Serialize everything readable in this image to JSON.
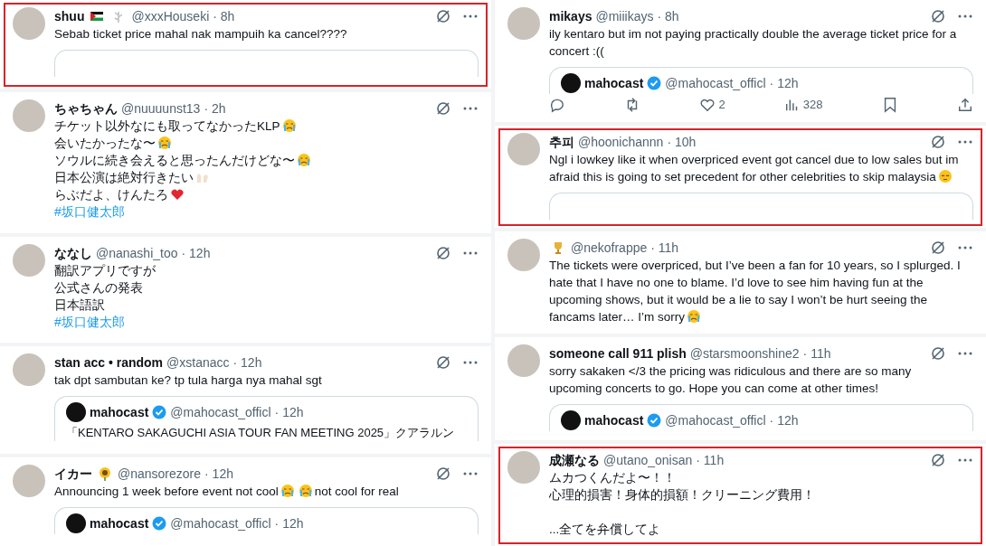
{
  "columns": [
    {
      "tweets": [
        {
          "name": [
            {
              "kind": "text",
              "text": "shuu"
            },
            {
              "kind": "flag"
            },
            {
              "kind": "sprig"
            }
          ],
          "handle": "@xxxHouseki",
          "time": "· 8h",
          "highlighted": true,
          "lines": [
            [
              {
                "kind": "text",
                "text": "Sebab ticket price mahal nak mampuih ka cancel????"
              }
            ]
          ],
          "quote": {
            "kind": "empty"
          }
        },
        {
          "name": [
            {
              "kind": "text",
              "text": "ちゃちゃん"
            }
          ],
          "handle": "@nuuuunst13",
          "time": "· 2h",
          "highlighted": false,
          "lines": [
            [
              {
                "kind": "text",
                "text": "チケット以外なにも取ってなかったKLP"
              },
              {
                "kind": "crying"
              }
            ],
            [
              {
                "kind": "text",
                "text": "会いたかったな〜"
              },
              {
                "kind": "crying"
              }
            ],
            [
              {
                "kind": "text",
                "text": "ソウルに続き会えると思ったんだけどな〜"
              },
              {
                "kind": "crying"
              }
            ],
            [
              {
                "kind": "text",
                "text": "日本公演は絶対行きたい"
              },
              {
                "kind": "hands"
              }
            ],
            [
              {
                "kind": "text",
                "text": "らぶだよ、けんたろ"
              },
              {
                "kind": "heart"
              }
            ]
          ],
          "hashtag": "#坂口健太郎"
        },
        {
          "name": [
            {
              "kind": "text",
              "text": "ななし"
            }
          ],
          "handle": "@nanashi_too",
          "time": "· 12h",
          "highlighted": false,
          "lines": [
            [
              {
                "kind": "text",
                "text": "翻訳アプリですが"
              }
            ],
            [
              {
                "kind": "text",
                "text": "公式さんの発表"
              }
            ],
            [
              {
                "kind": "text",
                "text": "日本語訳"
              }
            ]
          ],
          "hashtag": "#坂口健太郎"
        },
        {
          "name": [
            {
              "kind": "text",
              "text": "stan acc • random"
            }
          ],
          "handle": "@xstanacc",
          "time": "· 12h",
          "highlighted": false,
          "lines": [
            [
              {
                "kind": "text",
                "text": "tak dpt sambutan ke? tp tula harga nya mahal sgt"
              }
            ]
          ],
          "quote": {
            "kind": "post",
            "name": "mahocast",
            "handle": "@mahocast_officl",
            "time": "· 12h",
            "text": "「KENTARO SAKAGUCHI ASIA TOUR FAN MEETING 2025」クアラルン"
          }
        },
        {
          "name": [
            {
              "kind": "text",
              "text": "イカー"
            },
            {
              "kind": "sunflower"
            }
          ],
          "handle": "@nansorezore",
          "time": "· 12h",
          "highlighted": false,
          "lines": [
            [
              {
                "kind": "text",
                "text": "Announcing 1 week before event not cool"
              },
              {
                "kind": "crying"
              },
              {
                "kind": "crying"
              },
              {
                "kind": "text",
                "text": "not cool for real"
              }
            ]
          ],
          "quote": {
            "kind": "post",
            "name": "mahocast",
            "handle": "@mahocast_officl",
            "time": "· 12h"
          }
        }
      ]
    },
    {
      "tweets": [
        {
          "name": [
            {
              "kind": "text",
              "text": "mikays"
            }
          ],
          "handle": "@miiikays",
          "time": "· 8h",
          "highlighted": false,
          "lines": [
            [
              {
                "kind": "text",
                "text": "ily kentaro but im not paying practically double the average ticket price for a"
              }
            ],
            [
              {
                "kind": "text",
                "text": "concert :(("
              }
            ]
          ],
          "quote": {
            "kind": "post",
            "name": "mahocast",
            "handle": "@mahocast_officl",
            "time": "· 12h"
          },
          "actions": [
            {
              "kind": "reply"
            },
            {
              "kind": "retweet"
            },
            {
              "kind": "like",
              "count": "2"
            },
            {
              "kind": "views",
              "count": "328"
            },
            {
              "kind": "bookmark"
            },
            {
              "kind": "share"
            }
          ]
        },
        {
          "name": [
            {
              "kind": "text",
              "text": "추피"
            }
          ],
          "handle": "@hoonichannn",
          "time": "· 10h",
          "highlighted": true,
          "lines": [
            [
              {
                "kind": "text",
                "text": "Ngl i lowkey like it when overpriced event got cancel due to low sales but im"
              }
            ],
            [
              {
                "kind": "text",
                "text": "afraid this is going to set precedent for other celebrities to skip malaysia"
              },
              {
                "kind": "pensive"
              }
            ]
          ],
          "quote": {
            "kind": "empty"
          }
        },
        {
          "name": [
            {
              "kind": "trophy"
            }
          ],
          "handle": "@nekofrappe",
          "time": "· 11h",
          "highlighted": false,
          "lines": [
            [
              {
                "kind": "text",
                "text": "The tickets were overpriced, but I’ve been a fan for 10 years, so I splurged. I"
              }
            ],
            [
              {
                "kind": "text",
                "text": "hate that I have no one to blame. I’d love to see him having fun at the"
              }
            ],
            [
              {
                "kind": "text",
                "text": "upcoming shows, but it would be a lie to say I won’t be hurt seeing the"
              }
            ],
            [
              {
                "kind": "text",
                "text": "fancams later… I’m sorry"
              },
              {
                "kind": "crying"
              }
            ]
          ]
        },
        {
          "name": [
            {
              "kind": "text",
              "text": "someone call 911 plish"
            }
          ],
          "handle": "@starsmoonshine2",
          "time": "· 11h",
          "highlighted": false,
          "lines": [
            [
              {
                "kind": "text",
                "text": "sorry sakaken </3 the pricing was ridiculous and there are so many"
              }
            ],
            [
              {
                "kind": "text",
                "text": "upcoming concerts to go. Hope you can come at other times!"
              }
            ]
          ],
          "quote": {
            "kind": "post",
            "name": "mahocast",
            "handle": "@mahocast_officl",
            "time": "· 12h"
          }
        },
        {
          "name": [
            {
              "kind": "text",
              "text": "成瀬なる"
            }
          ],
          "handle": "@utano_onisan",
          "time": "· 11h",
          "highlighted": true,
          "lines": [
            [
              {
                "kind": "text",
                "text": "ムカつくんだよ〜！！"
              }
            ],
            [
              {
                "kind": "text",
                "text": "心理的損害！身体的損額！クリーニング費用！"
              }
            ],
            [
              {
                "kind": "blank"
              }
            ],
            [
              {
                "kind": "text",
                "text": "...全てを弁償してよ"
              }
            ]
          ]
        }
      ]
    }
  ]
}
